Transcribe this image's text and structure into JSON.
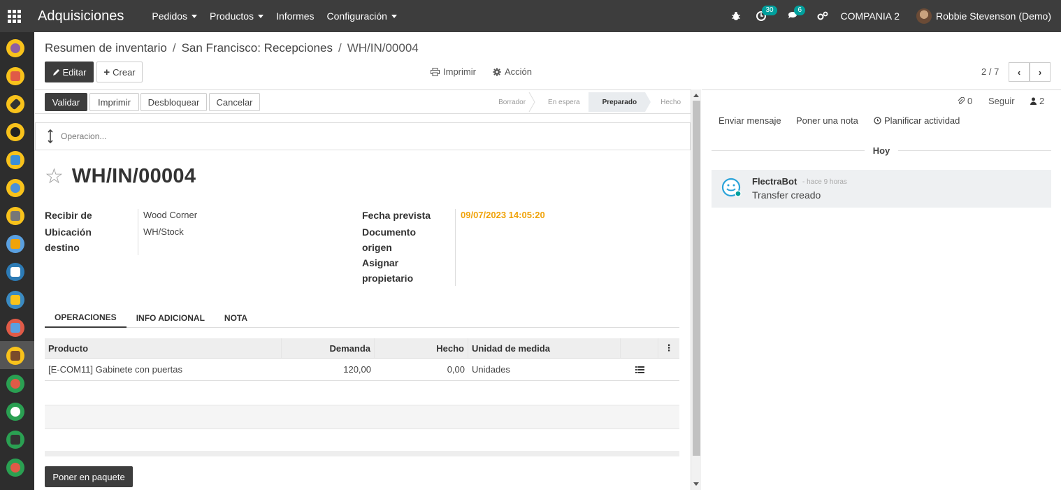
{
  "navbar": {
    "brand": "Adquisiciones",
    "menus": [
      "Pedidos",
      "Productos",
      "Informes",
      "Configuración"
    ],
    "activity_count": "30",
    "message_count": "6",
    "company": "COMPANIA 2",
    "user": "Robbie Stevenson (Demo)"
  },
  "breadcrumb": {
    "items": [
      "Resumen de inventario",
      "San Francisco: Recepciones",
      "WH/IN/00004"
    ]
  },
  "control": {
    "edit": "Editar",
    "create": "Crear",
    "print": "Imprimir",
    "action": "Acción",
    "pager": "2 / 7"
  },
  "statusbar": {
    "buttons": [
      "Validar",
      "Imprimir",
      "Desbloquear",
      "Cancelar"
    ],
    "stages": [
      "Borrador",
      "En espera",
      "Preparado",
      "Hecho"
    ],
    "current_stage": "Preparado"
  },
  "operation_placeholder": "Operacion...",
  "form": {
    "title": "WH/IN/00004",
    "receive_from_label": "Recibir de",
    "receive_from": "Wood Corner",
    "dest_label_1": "Ubicación",
    "dest_label_2": "destino",
    "dest": "WH/Stock",
    "scheduled_label": "Fecha prevista",
    "scheduled": "09/07/2023 14:05:20",
    "source_label_1": "Documento",
    "source_label_2": "origen",
    "owner_label_1": "Asignar",
    "owner_label_2": "propietario",
    "scheduled_color": "#f0a30a"
  },
  "tabs": [
    "OPERACIONES",
    "INFO ADICIONAL",
    "NOTA"
  ],
  "table": {
    "headers": [
      "Producto",
      "Demanda",
      "Hecho",
      "Unidad de medida"
    ],
    "rows": [
      [
        "[E-COM11] Gabinete con puertas",
        "120,00",
        "0,00",
        "Unidades"
      ]
    ]
  },
  "footer_button": "Poner en paquete",
  "chatter": {
    "attachments": "0",
    "follow": "Seguir",
    "followers": "2",
    "send_message": "Enviar mensaje",
    "log_note": "Poner una nota",
    "schedule": "Planificar actividad",
    "today": "Hoy",
    "message": {
      "author": "FlectraBot",
      "ago": "- hace 9 horas",
      "body": "Transfer creado"
    }
  }
}
